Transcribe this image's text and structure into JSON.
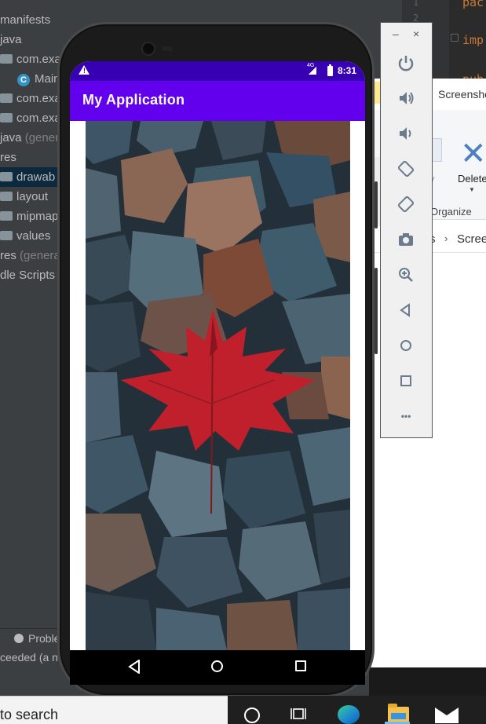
{
  "ide": {
    "tree": [
      {
        "label": "manifests",
        "muted": ""
      },
      {
        "label": "java",
        "muted": ""
      },
      {
        "label": "com.exa",
        "muted": ""
      },
      {
        "label": "Main",
        "muted": ""
      },
      {
        "label": "com.exa",
        "muted": ""
      },
      {
        "label": "com.exa",
        "muted": ""
      },
      {
        "label": "java",
        "muted": " (gener"
      },
      {
        "label": "res",
        "muted": ""
      },
      {
        "label": "drawab",
        "muted": ""
      },
      {
        "label": "layout",
        "muted": ""
      },
      {
        "label": "mipmap",
        "muted": ""
      },
      {
        "label": "values",
        "muted": ""
      },
      {
        "label": "res",
        "muted": " (genera"
      },
      {
        "label": "dle Scripts",
        "muted": ""
      }
    ],
    "problems_label": "Proble",
    "build_status": "ceeded (a n"
  },
  "editor": {
    "line_numbers": [
      "1",
      "2"
    ],
    "lines": [
      "pac",
      "imp",
      "pub"
    ]
  },
  "explorer": {
    "title": "Screensho",
    "copy_label": "y",
    "delete_label": "Delete",
    "organize_label": "Organize",
    "address_partial": "s",
    "address_folder": "Scree"
  },
  "phone": {
    "status_time": "8:31",
    "network_label": "4G",
    "app_title": "My Application",
    "photo_icon": "image-icon"
  },
  "emulator_toolbar": {
    "minimize_label": "–",
    "close_label": "×",
    "buttons": [
      "power-icon",
      "volume-up-icon",
      "volume-down-icon",
      "rotate-left-icon",
      "rotate-right-icon",
      "camera-icon",
      "zoom-icon",
      "back-icon",
      "home-icon",
      "overview-icon",
      "more-icon"
    ],
    "more_label": "•••"
  },
  "taskbar": {
    "search_text": "to search"
  },
  "colors": {
    "status_bar": "#3700b3",
    "app_bar": "#6200ee",
    "ide_bg": "#3c3f41",
    "leaf_red": "#c0202b"
  }
}
